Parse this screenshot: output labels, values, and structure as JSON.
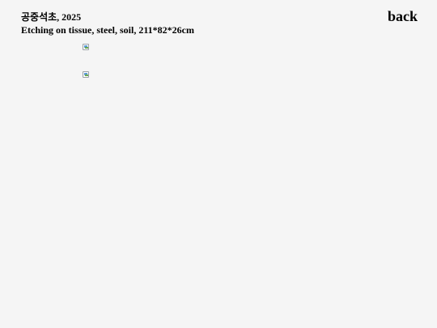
{
  "artwork": {
    "title": "공중석초, 2025",
    "details": "Etching on tissue, steel, soil, 211*82*26cm"
  },
  "nav": {
    "back_label": "back"
  },
  "images": [
    {
      "icon": "broken-image-icon"
    },
    {
      "icon": "broken-image-icon"
    }
  ]
}
